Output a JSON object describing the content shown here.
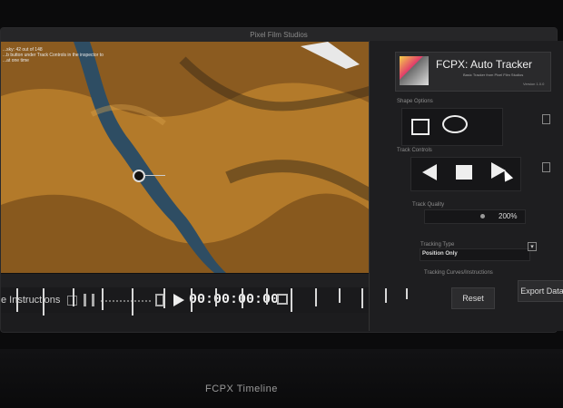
{
  "window": {
    "title": "Pixel Film Studios"
  },
  "viewer": {
    "overlay_lines": [
      "...sky: 42 out of 148",
      "...b button under Track Controls in the inspector to",
      "...at one time"
    ]
  },
  "transport": {
    "instructions_label": "e Instructions",
    "timecode": "00:00:00:00",
    "play_glyph": "play-icon"
  },
  "timeline": {
    "label": "FCPX Timeline"
  },
  "plugin": {
    "title": "FCPX: Auto Tracker",
    "subtitle": "Basic Tracker from Pixel Film Studios",
    "version": "Version 1.0.0",
    "shape_options_label": "Shape Options",
    "track_controls_label": "Track Controls",
    "track_quality_label": "Track Quality",
    "track_quality_value": "200%",
    "tracking_type_label": "Tracking Type",
    "tracking_type_value": "Position Only",
    "reset_label": "Reset",
    "export_label": "Export Data",
    "extra_label": "Tracking Curves/Instructions"
  },
  "colors": {
    "ground": "#b37a2a",
    "river": "#2e4d63",
    "panel": "#1e1e20"
  }
}
